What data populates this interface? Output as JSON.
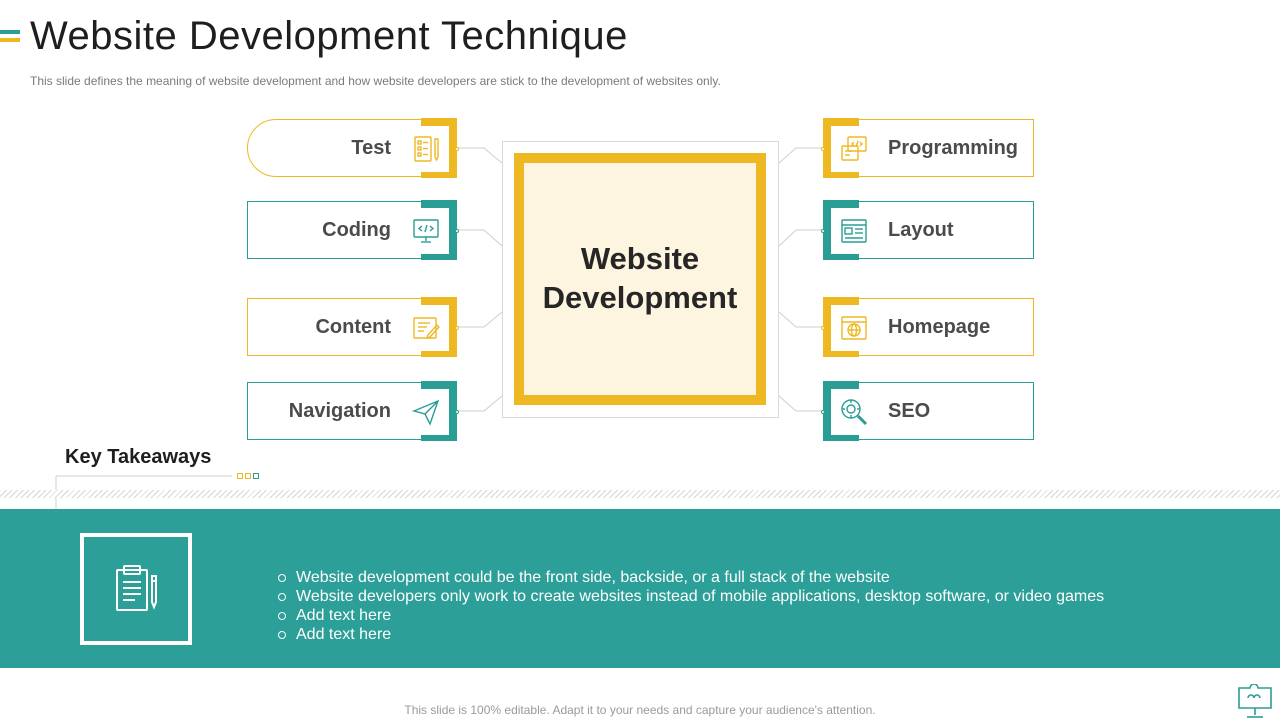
{
  "title": "Website Development Technique",
  "subtitle": "This slide defines the meaning of website development  and how website developers  are stick to the development  of websites only.",
  "center_label": "Website Development",
  "left_items": [
    {
      "label": "Test",
      "icon": "checklist-icon"
    },
    {
      "label": "Coding",
      "icon": "monitor-code-icon"
    },
    {
      "label": "Content",
      "icon": "document-edit-icon"
    },
    {
      "label": "Navigation",
      "icon": "paper-plane-icon"
    }
  ],
  "right_items": [
    {
      "label": "Programming",
      "icon": "code-window-icon"
    },
    {
      "label": "Layout",
      "icon": "layout-icon"
    },
    {
      "label": "Homepage",
      "icon": "globe-window-icon"
    },
    {
      "label": "SEO",
      "icon": "magnifier-gear-icon"
    }
  ],
  "key_takeaways": {
    "title": "Key Takeaways",
    "icon": "clipboard-icon",
    "bullets": [
      "Website development could be the front side, backside, or a full stack of the website",
      "Website developers only work to create websites instead of mobile applications, desktop software, or video games",
      "Add text here",
      "Add text here"
    ]
  },
  "footer": "This slide is 100% editable. Adapt it to your needs and capture your audience's attention.",
  "colors": {
    "yellow": "#eeb822",
    "teal": "#2a9d95",
    "band": "#2c9f98",
    "center_fill": "#fdf5df"
  }
}
